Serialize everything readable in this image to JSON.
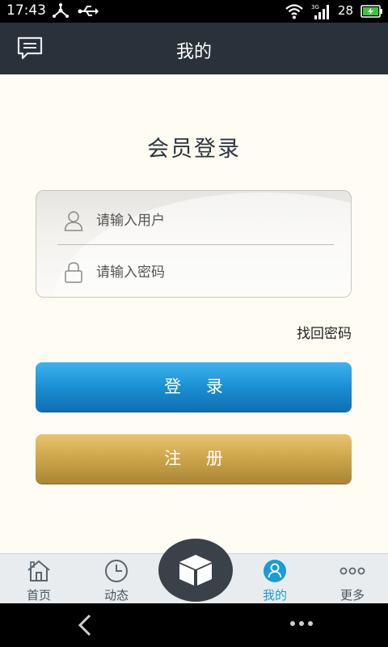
{
  "status_bar": {
    "time": "17:43",
    "battery_level": "28",
    "network_label": "3G"
  },
  "header": {
    "title": "我的"
  },
  "login": {
    "heading": "会员登录",
    "username_placeholder": "请输入用户",
    "password_placeholder": "请输入密码",
    "forgot_password": "找回密码",
    "login_button": "登 录",
    "register_button": "注 册"
  },
  "tabs": [
    {
      "label": "首页",
      "icon": "home-icon"
    },
    {
      "label": "动态",
      "icon": "clock-icon"
    },
    {
      "label": "",
      "icon": "box-icon"
    },
    {
      "label": "我的",
      "icon": "user-icon",
      "active": true
    },
    {
      "label": "更多",
      "icon": "more-icon"
    }
  ],
  "colors": {
    "header_bg": "#2a313b",
    "login_button": "#1a8fd3",
    "register_button": "#c9a146",
    "active_tab": "#1a9bdc",
    "page_bg": "#fffdf3"
  }
}
